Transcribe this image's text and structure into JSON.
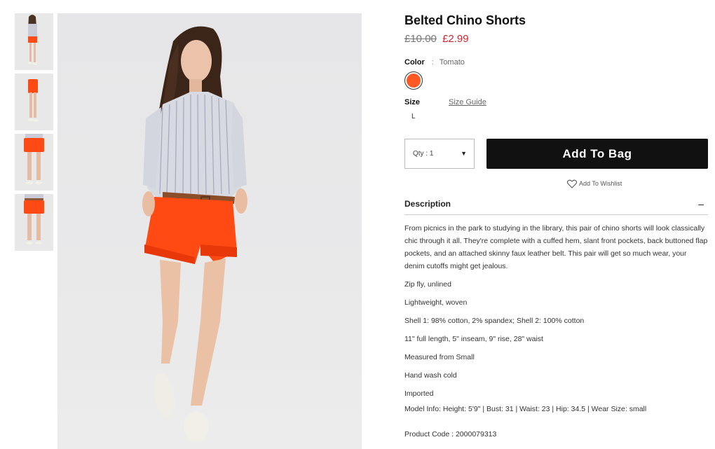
{
  "product": {
    "title": "Belted Chino Shorts",
    "price_old": "£10.00",
    "price_new": "£2.99"
  },
  "color": {
    "label": "Color",
    "separator": ":",
    "value": "Tomato",
    "swatch_color": "#ff5a26"
  },
  "size": {
    "label": "Size",
    "guide_label": "Size Guide",
    "options": [
      "L"
    ]
  },
  "purchase": {
    "qty_label": "Qty : 1",
    "caret": "▼",
    "add_to_bag": "Add To Bag",
    "wishlist": "Add To Wishlist"
  },
  "description": {
    "heading": "Description",
    "toggle": "–",
    "text": "From picnics in the park to studying in the library, this pair of chino shorts will look classically chic through it all. They're complete with a cuffed hem, slant front pockets, back buttoned flap pockets, and an attached skinny faux leather belt. This pair will get so much wear, your denim cutoffs might get jealous.",
    "bullets": [
      "Zip fly, unlined",
      "Lightweight, woven",
      "Shell 1: 98% cotton, 2% spandex; Shell 2: 100% cotton",
      "11\" full length, 5\" inseam, 9\" rise, 28\" waist",
      "Measured from Small",
      "Hand wash cold",
      "Imported"
    ],
    "model_info": "Model Info: Height: 5'9\" | Bust: 31 | Waist: 23 | Hip: 34.5 | Wear Size: small",
    "product_code": "Product Code : 2000079313"
  },
  "colors": {
    "accent_price": "#d0262c",
    "button_bg": "#111111",
    "shorts": "#ff4a14"
  }
}
